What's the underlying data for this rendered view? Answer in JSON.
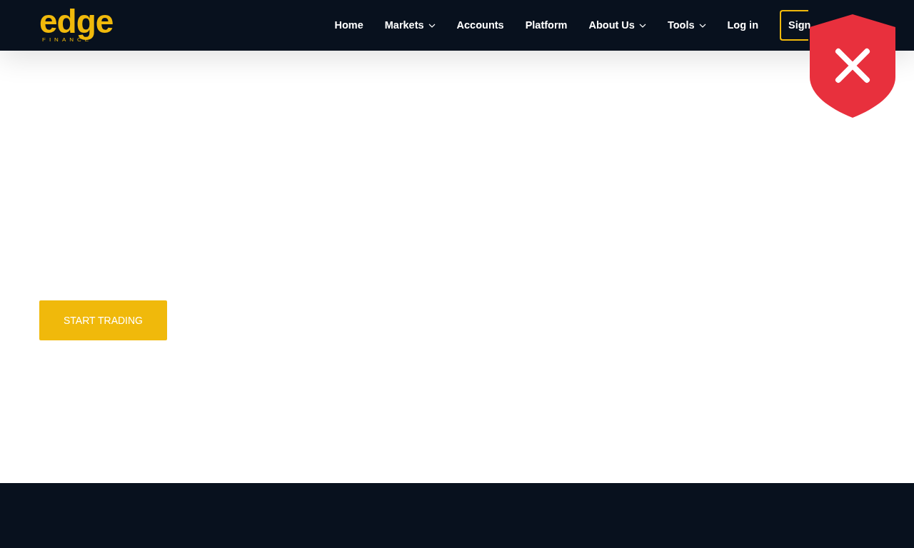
{
  "logo": {
    "wordmark": "edge",
    "tagline": "FINANCE"
  },
  "nav": [
    {
      "label": "Home",
      "has_menu": false
    },
    {
      "label": "Markets",
      "has_menu": true
    },
    {
      "label": "Accounts",
      "has_menu": false
    },
    {
      "label": "Platform",
      "has_menu": false
    },
    {
      "label": "About Us",
      "has_menu": true
    },
    {
      "label": "Tools",
      "has_menu": true
    },
    {
      "label": "Log in",
      "has_menu": false
    }
  ],
  "signup_button": {
    "label": "Sign"
  },
  "hero": {
    "cta": "START TRADING"
  },
  "blocked_badge": {
    "kind": "shield"
  }
}
